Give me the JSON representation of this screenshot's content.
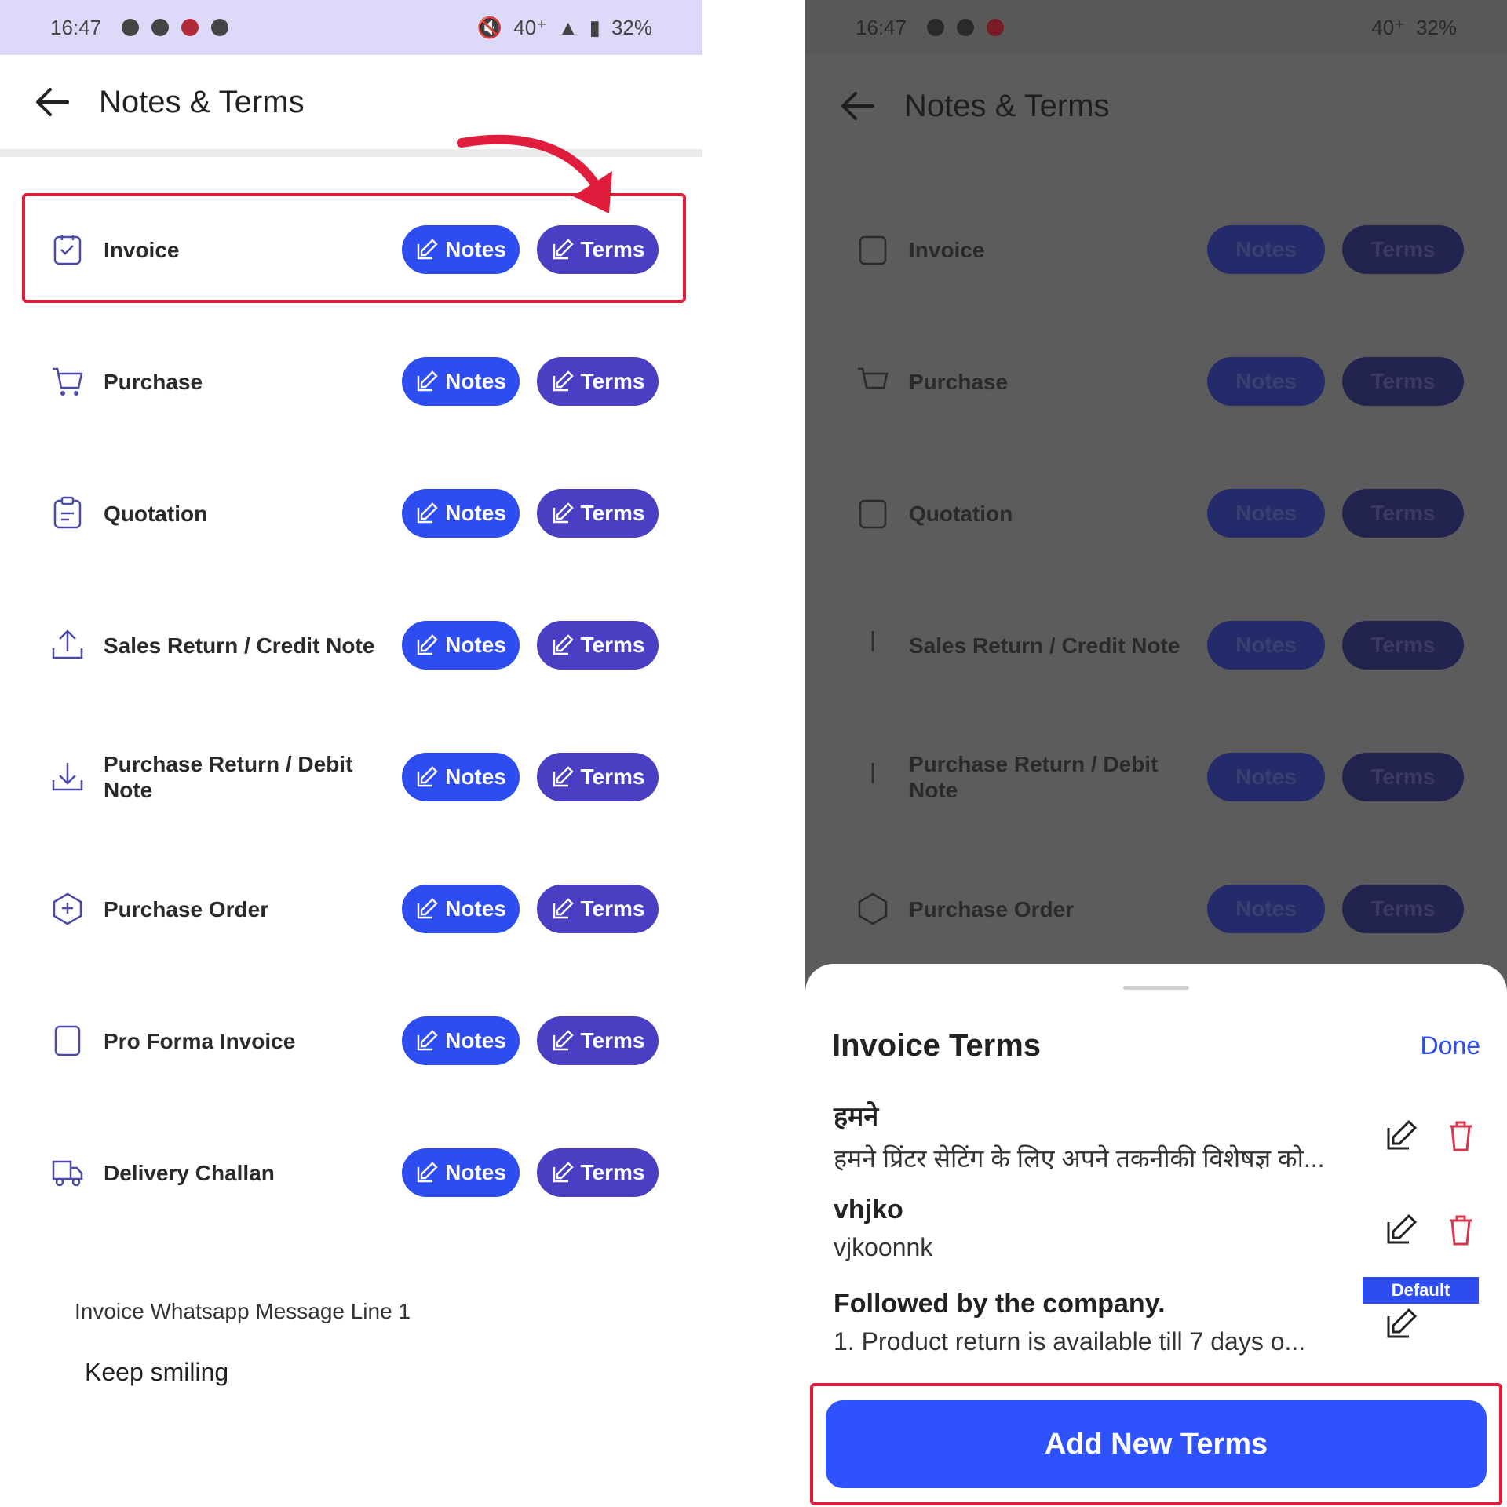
{
  "status_bar": {
    "time": "16:47",
    "network": "40⁺",
    "battery": "32%"
  },
  "app_bar": {
    "title": "Notes & Terms"
  },
  "rows": [
    {
      "label": "Invoice",
      "icon": "invoice-icon"
    },
    {
      "label": "Purchase",
      "icon": "cart-icon"
    },
    {
      "label": "Quotation",
      "icon": "quotation-icon"
    },
    {
      "label": "Sales Return / Credit Note",
      "icon": "upload-icon"
    },
    {
      "label": "Purchase Return / Debit Note",
      "icon": "download-icon"
    },
    {
      "label": "Purchase Order",
      "icon": "order-icon"
    },
    {
      "label": "Pro Forma Invoice",
      "icon": "document-icon"
    },
    {
      "label": "Delivery Challan",
      "icon": "truck-icon"
    }
  ],
  "buttons": {
    "notes_label": "Notes",
    "terms_label": "Terms"
  },
  "whatsapp": {
    "label": "Invoice Whatsapp Message Line 1",
    "value": "Keep smiling"
  },
  "sheet": {
    "title": "Invoice Terms",
    "done_label": "Done",
    "terms": [
      {
        "title": "हमने",
        "body": "हमने प्रिंटर सेटिंग के लिए अपने तकनीकी विशेषज्ञ को..."
      },
      {
        "title": "vhjko",
        "body": "vjkoonnk"
      },
      {
        "title": "Followed by the company.",
        "body": "1. Product return is available till 7 days o..."
      }
    ],
    "default_badge": "Default",
    "add_button": "Add New Terms"
  },
  "colors": {
    "notes_pill": "#2d4df0",
    "terms_pill": "#4a3fc2",
    "highlight": "#e01d3c",
    "primary": "#2f52ff"
  }
}
